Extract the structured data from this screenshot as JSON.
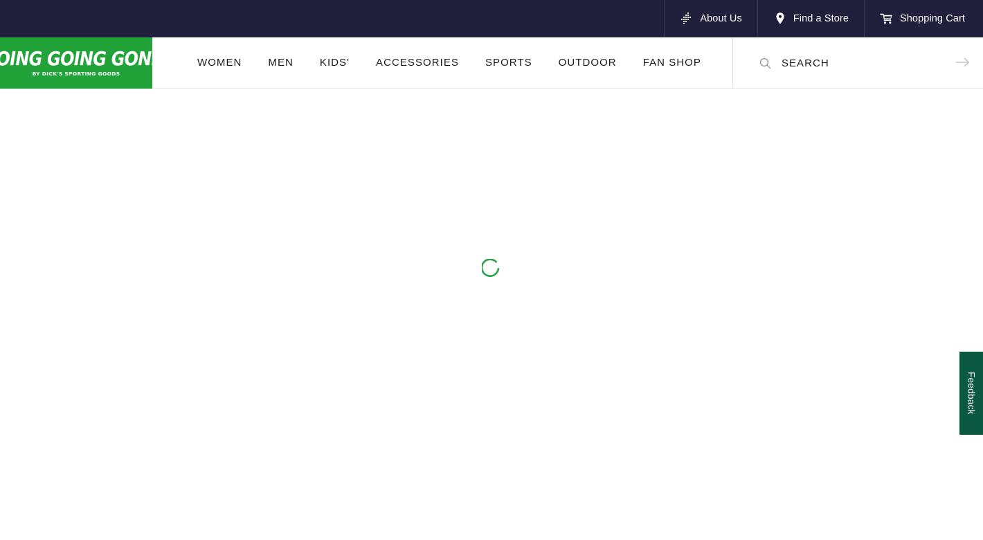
{
  "utility_bar": {
    "background_color": "#20203c",
    "items": [
      {
        "label": "About Us",
        "icon": "ggg-dotted-arrow-icon"
      },
      {
        "label": "Find a Store",
        "icon": "map-pin-icon"
      },
      {
        "label": "Shopping Cart",
        "icon": "shopping-cart-icon"
      }
    ]
  },
  "logo": {
    "main_text": "GOING GOING GONE!",
    "sub_text": "BY DICK'S SPORTING GOODS",
    "background_color": "#22a33a"
  },
  "nav": {
    "items": [
      {
        "label": "WOMEN"
      },
      {
        "label": "MEN"
      },
      {
        "label": "KIDS'"
      },
      {
        "label": "ACCESSORIES"
      },
      {
        "label": "SPORTS"
      },
      {
        "label": "OUTDOOR"
      },
      {
        "label": "FAN SHOP"
      }
    ]
  },
  "search": {
    "placeholder": "SEARCH",
    "value": "",
    "icon": "search-icon",
    "submit_icon": "arrow-right-icon"
  },
  "content": {
    "state": "loading",
    "spinner_color": "#2ba046"
  },
  "feedback": {
    "label": "Feedback",
    "background_color": "#0c5941"
  }
}
